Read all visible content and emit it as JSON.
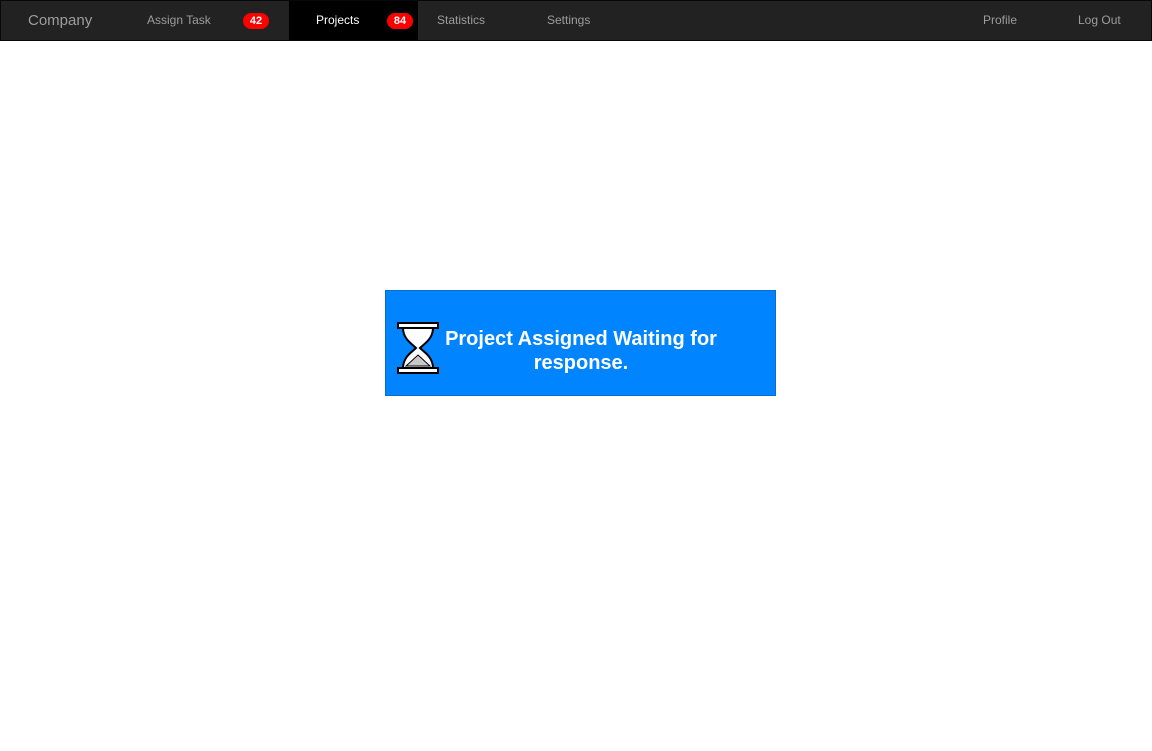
{
  "navbar": {
    "brand": "Company",
    "items": [
      {
        "label": "Assign Task",
        "badge": "42",
        "active": false
      },
      {
        "label": "Projects",
        "badge": "84",
        "active": true
      },
      {
        "label": "Statistics",
        "active": false
      },
      {
        "label": "Settings",
        "active": false
      }
    ],
    "right_items": [
      {
        "label": "Profile"
      },
      {
        "label": "Log Out"
      }
    ]
  },
  "notice": {
    "icon": "hourglass-icon",
    "message": "Project Assigned Waiting for response."
  },
  "colors": {
    "navbar_bg": "#222222",
    "active_bg": "#000000",
    "badge": "#ff0000",
    "notice_bg": "#0084ff"
  }
}
